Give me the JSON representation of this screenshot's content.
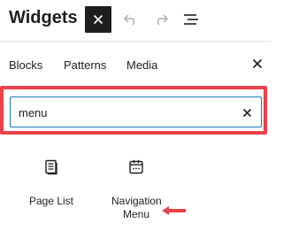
{
  "header": {
    "title": "Widgets",
    "close_icon": "close-icon",
    "undo_icon": "undo-icon",
    "redo_icon": "redo-icon",
    "list_view_icon": "list-view-icon"
  },
  "tabs": {
    "items": [
      {
        "label": "Blocks"
      },
      {
        "label": "Patterns"
      },
      {
        "label": "Media"
      }
    ],
    "close_icon": "close-icon"
  },
  "search": {
    "value": "menu",
    "clear_icon": "close-icon",
    "highlight_color": "#e8424a",
    "focus_color": "#1e75b8"
  },
  "results": [
    {
      "label": "Page List",
      "icon": "page-list-icon"
    },
    {
      "label": "Navigation Menu",
      "icon": "navigation-icon"
    }
  ],
  "annotation": {
    "arrow_color": "#e8424a"
  }
}
